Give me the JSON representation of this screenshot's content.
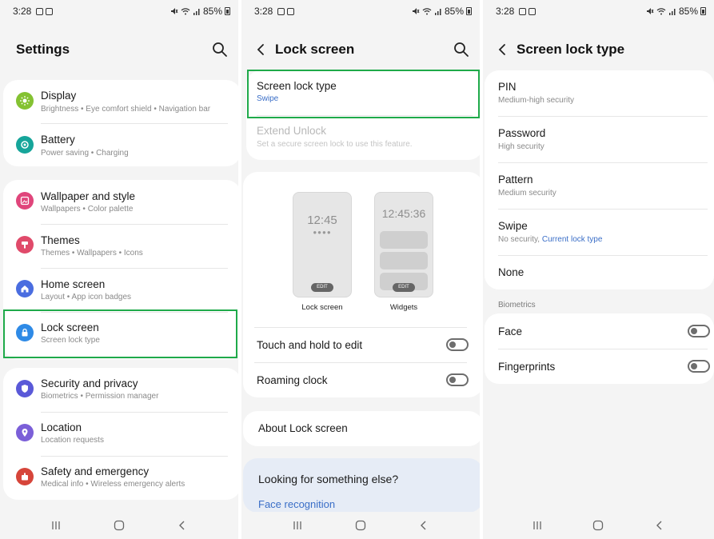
{
  "status": {
    "time": "3:28",
    "battery": "85%"
  },
  "settings": {
    "title": "Settings",
    "items": [
      {
        "title": "Display",
        "subtitle": "Brightness • Eye comfort shield • Navigation bar",
        "icon": "sun-icon",
        "color": "#84c232"
      },
      {
        "title": "Battery",
        "subtitle": "Power saving • Charging",
        "icon": "battery-icon",
        "color": "#16a59a"
      },
      {
        "title": "Wallpaper and style",
        "subtitle": "Wallpapers • Color palette",
        "icon": "image-icon",
        "color": "#e0457b"
      },
      {
        "title": "Themes",
        "subtitle": "Themes • Wallpapers • Icons",
        "icon": "brush-icon",
        "color": "#e04a6a"
      },
      {
        "title": "Home screen",
        "subtitle": "Layout • App icon badges",
        "icon": "home-icon",
        "color": "#4a6de0"
      },
      {
        "title": "Lock screen",
        "subtitle": "Screen lock type",
        "icon": "lock-icon",
        "color": "#2e8ae6"
      },
      {
        "title": "Security and privacy",
        "subtitle": "Biometrics • Permission manager",
        "icon": "shield-icon",
        "color": "#5a59d8"
      },
      {
        "title": "Location",
        "subtitle": "Location requests",
        "icon": "location-pin-icon",
        "color": "#7b5fd8"
      },
      {
        "title": "Safety and emergency",
        "subtitle": "Medical info • Wireless emergency alerts",
        "icon": "alert-icon",
        "color": "#d6453a"
      }
    ]
  },
  "lockscreen": {
    "title": "Lock screen",
    "screen_lock_type": {
      "title": "Screen lock type",
      "value": "Swipe"
    },
    "extend_unlock": {
      "title": "Extend Unlock",
      "subtitle": "Set a secure screen lock to use this feature."
    },
    "preview_clock_1": "12:45",
    "preview_clock_2": "12:45:36",
    "edit_label": "EDIT",
    "caption_lock": "Lock screen",
    "caption_widgets": "Widgets",
    "touch_hold": "Touch and hold to edit",
    "roaming_clock": "Roaming clock",
    "about": "About Lock screen",
    "looking": "Looking for something else?",
    "face_recognition": "Face recognition"
  },
  "locktype": {
    "title": "Screen lock type",
    "options": [
      {
        "title": "PIN",
        "subtitle": "Medium-high security"
      },
      {
        "title": "Password",
        "subtitle": "High security"
      },
      {
        "title": "Pattern",
        "subtitle": "Medium security"
      },
      {
        "title": "Swipe",
        "subtitle": "No security,",
        "subtitle_link": "Current lock type"
      },
      {
        "title": "None",
        "subtitle": ""
      }
    ],
    "biometrics_label": "Biometrics",
    "face": "Face",
    "fingerprints": "Fingerprints"
  },
  "colors": {
    "highlight": "#1faa4a",
    "link": "#3a6ec7"
  }
}
